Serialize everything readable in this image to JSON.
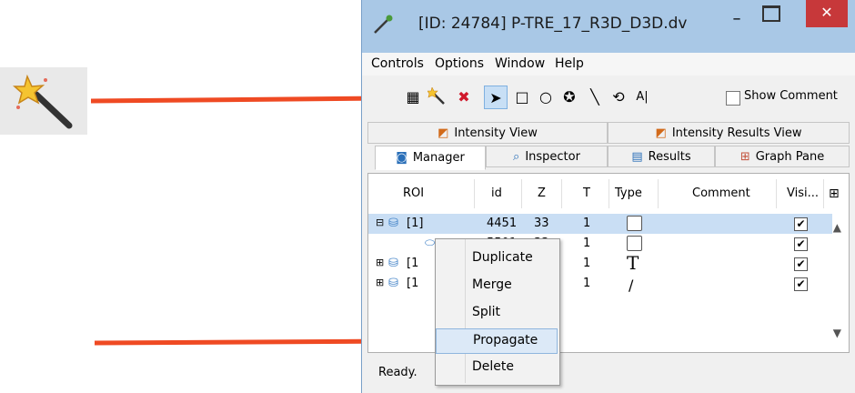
{
  "window": {
    "title": "[ID: 24784] P-TRE_17_R3D_D3D.dv",
    "minimize": "–",
    "close": "✕"
  },
  "menu": [
    "Controls",
    "Options",
    "Window",
    "Help"
  ],
  "toolbar": {
    "show_comment": "Show Comment",
    "line_tool_glyph": "╲",
    "text_tool_glyph": "A|"
  },
  "tabs_row1": [
    "Intensity View",
    "Intensity Results View"
  ],
  "tabs_row2": [
    "Manager",
    "Inspector",
    "Results",
    "Graph Pane"
  ],
  "columns": [
    "ROI",
    "id",
    "Z",
    "T",
    "Type",
    "Comment",
    "Visi..."
  ],
  "rows": [
    {
      "roi": "[1]",
      "id": "4451",
      "z": "33",
      "t": "1",
      "type": "box",
      "visible": "✔"
    },
    {
      "roi": "",
      "id": "5501",
      "z": "33",
      "t": "1",
      "type": "box",
      "visible": "✔"
    },
    {
      "roi": "[1",
      "id": "",
      "z": "",
      "t": "1",
      "type": "T",
      "visible": "✔"
    },
    {
      "roi": "[1",
      "id": "",
      "z": "",
      "t": "1",
      "type": "/",
      "visible": "✔"
    }
  ],
  "context_menu": [
    "Duplicate",
    "Merge",
    "Split",
    "Propagate",
    "Delete"
  ],
  "status": "Ready.",
  "colors": {
    "arrow": "#ef4a23",
    "title_bar": "#a9c8e6",
    "close_button": "#c7383a",
    "selection": "#c9def4"
  },
  "icons": {
    "external": "magic-wand-icon",
    "title": "pipette-icon"
  }
}
